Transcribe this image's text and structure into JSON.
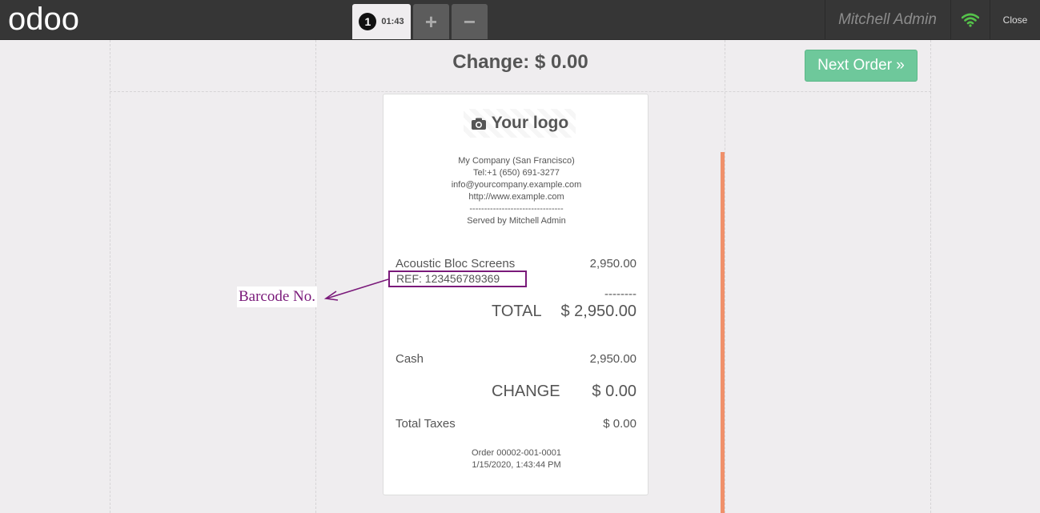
{
  "topbar": {
    "brand": "odoo",
    "order_number": "1",
    "order_time": "01:43",
    "add_label": "+",
    "remove_label": "−",
    "user": "Mitchell Admin",
    "close_label": "Close",
    "wifi_color": "#55c24a"
  },
  "screen": {
    "change_title": "Change: $ 0.00",
    "next_order_label": "Next Order »",
    "accent_color": "#6ec89b"
  },
  "receipt": {
    "logo_text": "Your logo",
    "company_lines": [
      "My Company (San Francisco)",
      "Tel:+1 (650) 691-3277",
      "info@yourcompany.example.com",
      "http://www.example.com",
      "--------------------------------",
      "Served by Mitchell Admin"
    ],
    "product_name": "Acoustic Bloc Screens",
    "product_price": "2,950.00",
    "ref": "REF: 123456789369",
    "separator": "--------",
    "total_label": "TOTAL",
    "total_value": "$ 2,950.00",
    "payment_label": "Cash",
    "payment_value": "2,950.00",
    "change_label": "CHANGE",
    "change_value": "$ 0.00",
    "taxes_label": "Total Taxes",
    "taxes_value": "$ 0.00",
    "order_ref": "Order 00002-001-0001",
    "order_date": "1/15/2020, 1:43:44 PM"
  },
  "annotation": {
    "label": "Barcode  No.",
    "color": "#7a1a7a"
  }
}
